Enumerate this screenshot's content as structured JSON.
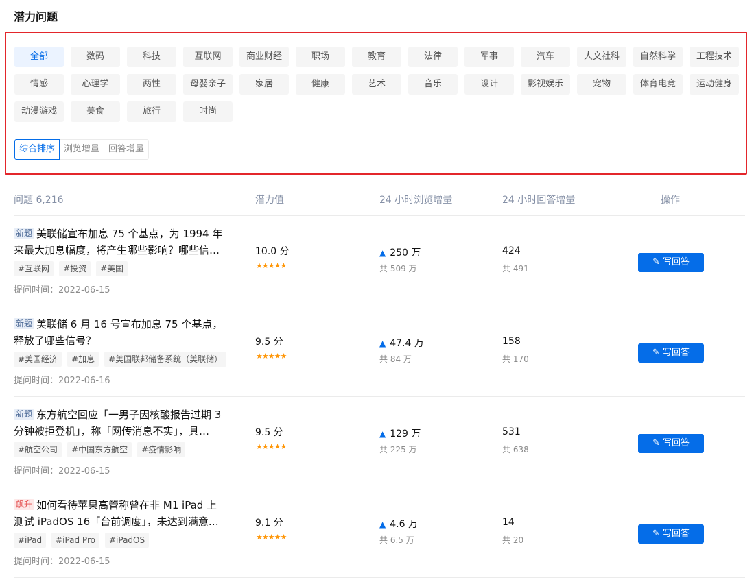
{
  "page_title": "潜力问题",
  "categories": [
    "全部",
    "数码",
    "科技",
    "互联网",
    "商业财经",
    "职场",
    "教育",
    "法律",
    "军事",
    "汽车",
    "人文社科",
    "自然科学",
    "工程技术",
    "情感",
    "心理学",
    "两性",
    "母婴亲子",
    "家居",
    "健康",
    "艺术",
    "音乐",
    "设计",
    "影视娱乐",
    "宠物",
    "体育电竞",
    "运动健身",
    "动漫游戏",
    "美食",
    "旅行",
    "时尚"
  ],
  "active_category": "全部",
  "sorts": [
    "综合排序",
    "浏览增量",
    "回答增量"
  ],
  "active_sort": "综合排序",
  "columns": {
    "question": "问题 6,216",
    "potential": "潜力值",
    "views_24h": "24 小时浏览增量",
    "answers_24h": "24 小时回答增量",
    "action": "操作"
  },
  "rows": [
    {
      "badge": "新题",
      "badge_type": "new",
      "title": "美联储宣布加息 75 个基点，为 1994 年来最大加息幅度，将产生哪些影响？哪些信…",
      "tags": [
        "#互联网",
        "#投资",
        "#美国"
      ],
      "asked_label": "提问时间：",
      "asked_date": "2022-06-15",
      "score": "10.0 分",
      "stars": "★★★★★",
      "views_inc": "250 万",
      "views_total": "共 509 万",
      "answers_inc": "424",
      "answers_total": "共 491",
      "button": "写回答"
    },
    {
      "badge": "新题",
      "badge_type": "new",
      "title": "美联储 6 月 16 号宣布加息 75 个基点，释放了哪些信号？",
      "tags": [
        "#美国经济",
        "#加息",
        "#美国联邦储备系统（美联储）"
      ],
      "asked_label": "提问时间：",
      "asked_date": "2022-06-16",
      "score": "9.5 分",
      "stars": "★★★★★",
      "views_inc": "47.4 万",
      "views_total": "共 84 万",
      "answers_inc": "158",
      "answers_total": "共 170",
      "button": "写回答"
    },
    {
      "badge": "新题",
      "badge_type": "new",
      "title": "东方航空回应「一男子因核酸报告过期 3 分钟被拒登机」，称「网传消息不实」，具…",
      "tags": [
        "#航空公司",
        "#中国东方航空",
        "#疫情影响"
      ],
      "asked_label": "提问时间：",
      "asked_date": "2022-06-15",
      "score": "9.5 分",
      "stars": "★★★★★",
      "views_inc": "129 万",
      "views_total": "共 225 万",
      "answers_inc": "531",
      "answers_total": "共 638",
      "button": "写回答"
    },
    {
      "badge": "飙升",
      "badge_type": "hot",
      "title": "如何看待苹果高管称曾在非 M1 iPad 上测试 iPadOS 16「台前调度」，未达到满意…",
      "tags": [
        "#iPad",
        "#iPad Pro",
        "#iPadOS"
      ],
      "asked_label": "提问时间：",
      "asked_date": "2022-06-15",
      "score": "9.1 分",
      "stars": "★★★★★",
      "views_inc": "4.6 万",
      "views_total": "共 6.5 万",
      "answers_inc": "14",
      "answers_total": "共 20",
      "button": "写回答"
    }
  ],
  "colors": {
    "accent": "#056de8",
    "highlight_border": "#e3262b",
    "star": "#ff9607"
  },
  "icons": {
    "views_arrow": "arrow-up-icon",
    "write": "pencil-icon"
  }
}
